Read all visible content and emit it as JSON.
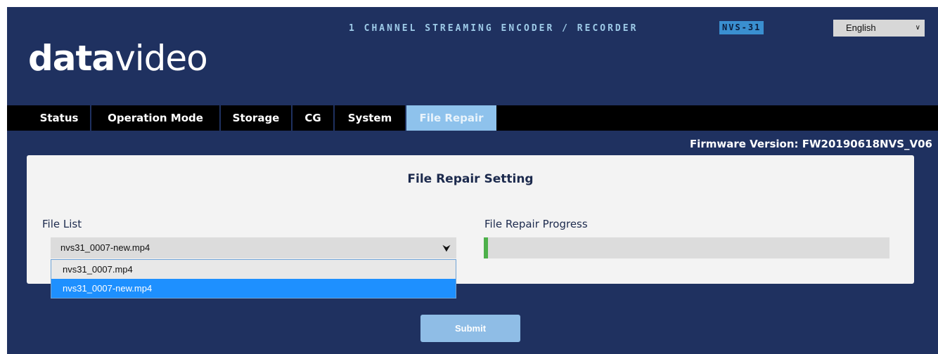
{
  "header": {
    "logo_bold": "data",
    "logo_light": "video",
    "product_title": "1 CHANNEL STREAMING ENCODER / RECORDER",
    "model": "NVS-31",
    "language": "English"
  },
  "nav": {
    "tabs": [
      {
        "label": "Status"
      },
      {
        "label": "Operation Mode"
      },
      {
        "label": "Storage"
      },
      {
        "label": "CG"
      },
      {
        "label": "System"
      },
      {
        "label": "File Repair",
        "active": true
      }
    ]
  },
  "firmware": "Firmware Version: FW20190618NVS_V06",
  "panel": {
    "title": "File Repair Setting",
    "file_list_label": "File List",
    "selected_file": "nvs31_0007-new.mp4",
    "options": [
      "nvs31_0007.mp4",
      "nvs31_0007-new.mp4"
    ],
    "progress_label": "File Repair Progress",
    "progress_percent": 1
  },
  "submit_label": "Submit",
  "colors": {
    "background": "#1f3160",
    "active_tab": "#8ec2ec",
    "progress": "#4db04a",
    "selected_option": "#1e90ff"
  }
}
